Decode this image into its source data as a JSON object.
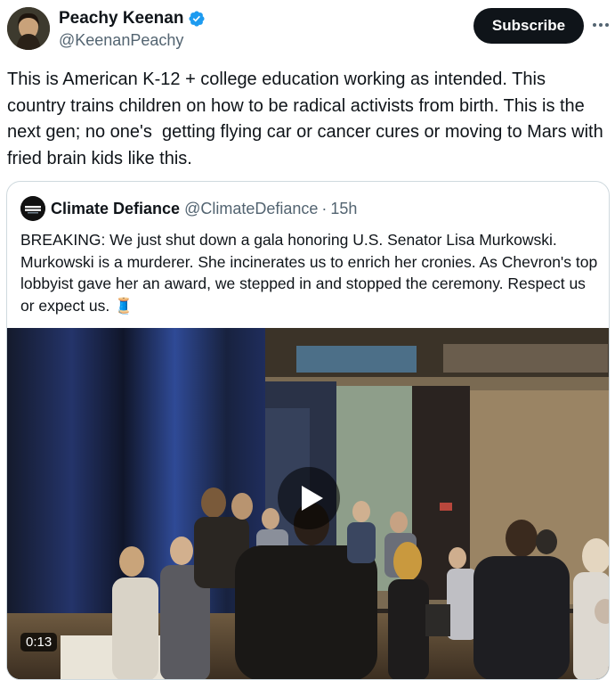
{
  "author": {
    "name": "Peachy Keenan",
    "handle": "@KeenanPeachy"
  },
  "actions": {
    "subscribe_label": "Subscribe"
  },
  "tweet": {
    "text": "This is American K-12 + college education working as intended. This country trains children on how to be radical activists from birth. This is the next gen; no one's  getting flying car or cancer cures or moving to Mars with fried brain kids like this."
  },
  "quote": {
    "author_name": "Climate Defiance",
    "author_handle": "@ClimateDefiance",
    "separator": "·",
    "time": "15h",
    "text": "BREAKING: We just shut down a gala honoring U.S. Senator Lisa Murkowski. Murkowski is a murderer. She incinerates us to enrich her cronies. As Chevron's top lobbyist gave her an award, we stepped in and stopped the ceremony. Respect us or expect us. 🧵",
    "video": {
      "duration": "0:13"
    }
  },
  "colors": {
    "text": "#0f1419",
    "secondary": "#536471",
    "verified": "#1d9bf0",
    "border": "#cfd9de"
  },
  "icons": [
    "verified-badge-icon",
    "more-icon",
    "play-icon"
  ]
}
